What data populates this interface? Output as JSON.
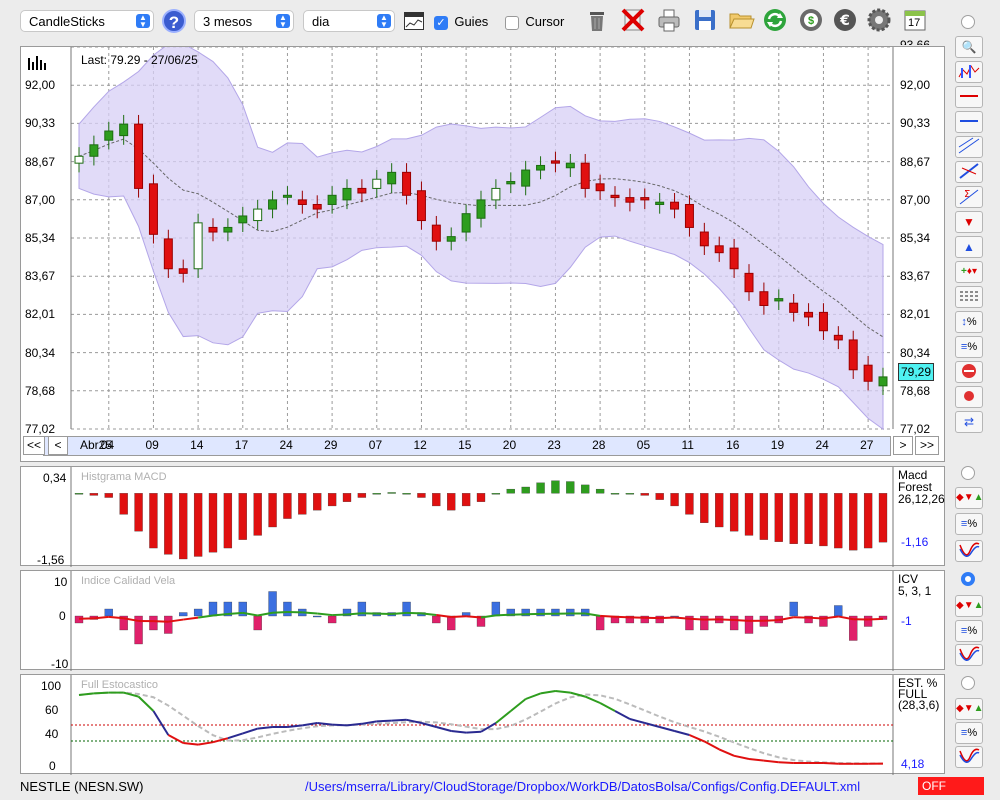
{
  "toolbar": {
    "chart_type": "CandleSticks",
    "period": "3 mesos",
    "interval": "dia",
    "guides_label": "Guies",
    "guides_checked": true,
    "cursor_label": "Cursor",
    "cursor_checked": false,
    "calendar_day": "17"
  },
  "main_chart": {
    "last_label": "Last: 79.29 - 27/06/25",
    "price_tag": "79,29",
    "y_ticks": [
      "93,66",
      "92,00",
      "90,33",
      "88,67",
      "87,00",
      "85,34",
      "83,67",
      "82,01",
      "80,34",
      "78,68",
      "77,02"
    ],
    "x_ticks": [
      "Abr25",
      "04",
      "09",
      "14",
      "17",
      "24",
      "29",
      "07",
      "12",
      "15",
      "20",
      "23",
      "28",
      "05",
      "11",
      "16",
      "19",
      "24",
      "27"
    ],
    "nav": {
      "first": "<<",
      "prev": "<",
      "next": ">",
      "last": ">>"
    }
  },
  "macd_panel": {
    "title": "Histgrama MACD",
    "y_top": "0,34",
    "y_bottom": "-1,56",
    "name": "Macd",
    "sub": "Forest",
    "params": "26,12,26",
    "value": "-1,16"
  },
  "icv_panel": {
    "title": "Indice Calidad Vela",
    "y_top": "10",
    "y_mid": "0",
    "y_bottom": "-10",
    "name": "ICV",
    "params": "5, 3, 1",
    "value": "-1"
  },
  "stoch_panel": {
    "title": "Full Estocastico",
    "y_ticks": [
      "100",
      "60",
      "40",
      "0"
    ],
    "name": "EST. %",
    "sub": "FULL",
    "params": "(28,3,6)",
    "value": "4,18"
  },
  "status": {
    "ticker": "NESTLE (NESN.SW)",
    "path": "/Users/mserra/Library/CloudStorage/Dropbox/WorkDB/DatosBolsa/Configs/Config.DEFAULT.xml",
    "toggle": "OFF"
  },
  "colors": {
    "up": "#2e9d1e",
    "down": "#e01010",
    "band": "#d7cff5",
    "macd_up": "#2e9d1e",
    "macd_down": "#e01010",
    "icv_pos": "#3b6fe0",
    "icv_neg": "#e0206a",
    "link": "#1a1aff",
    "off": "#ff1a1a"
  },
  "chart_data": {
    "type": "candlestick",
    "ylim": [
      77.02,
      93.66
    ],
    "closes": [
      88.9,
      89.4,
      90.0,
      90.3,
      87.5,
      85.5,
      84.0,
      83.8,
      86.0,
      85.6,
      85.8,
      86.3,
      86.6,
      87.0,
      87.2,
      86.8,
      86.6,
      87.2,
      87.5,
      87.3,
      87.9,
      88.2,
      87.2,
      86.1,
      85.2,
      85.4,
      86.4,
      87.0,
      87.5,
      87.8,
      88.3,
      88.5,
      88.6,
      88.6,
      87.5,
      87.4,
      87.1,
      86.9,
      87.0,
      86.9,
      86.6,
      85.8,
      85.0,
      84.7,
      84.0,
      83.0,
      82.4,
      82.7,
      82.1,
      81.9,
      81.3,
      80.9,
      79.6,
      79.1,
      79.29
    ],
    "macd_hist": [
      0.0,
      -0.05,
      -0.1,
      -0.5,
      -0.9,
      -1.3,
      -1.45,
      -1.56,
      -1.5,
      -1.4,
      -1.3,
      -1.1,
      -1.0,
      -0.8,
      -0.6,
      -0.5,
      -0.4,
      -0.3,
      -0.2,
      -0.1,
      0.0,
      0.02,
      0.0,
      -0.1,
      -0.3,
      -0.4,
      -0.3,
      -0.2,
      0.0,
      0.1,
      0.15,
      0.25,
      0.3,
      0.28,
      0.2,
      0.1,
      0.0,
      0.0,
      -0.05,
      -0.15,
      -0.3,
      -0.5,
      -0.7,
      -0.8,
      -0.9,
      -1.0,
      -1.1,
      -1.15,
      -1.2,
      -1.2,
      -1.25,
      -1.3,
      -1.35,
      -1.3,
      -1.16
    ],
    "icv": [
      -2,
      -1,
      2,
      -4,
      -8,
      -4,
      -5,
      1,
      2,
      4,
      4,
      4,
      -4,
      7,
      4,
      2,
      0,
      -2,
      2,
      4,
      1,
      1,
      4,
      1,
      -2,
      -4,
      1,
      -3,
      4,
      2,
      2,
      2,
      2,
      2,
      2,
      -4,
      -2,
      -2,
      -2,
      -2,
      0,
      -4,
      -4,
      -2,
      -4,
      -5,
      -3,
      -2,
      4,
      -2,
      -3,
      3,
      -7,
      -3,
      -1
    ],
    "stochastic": [
      90,
      92,
      93,
      93,
      88,
      70,
      40,
      30,
      28,
      31,
      36,
      42,
      48,
      50,
      50,
      52,
      55,
      53,
      52,
      54,
      57,
      58,
      59,
      55,
      50,
      45,
      43,
      44,
      55,
      70,
      85,
      92,
      95,
      93,
      88,
      80,
      70,
      60,
      55,
      50,
      45,
      40,
      32,
      22,
      14,
      10,
      8,
      6,
      5,
      5,
      5,
      4,
      4,
      4,
      4.18
    ]
  }
}
